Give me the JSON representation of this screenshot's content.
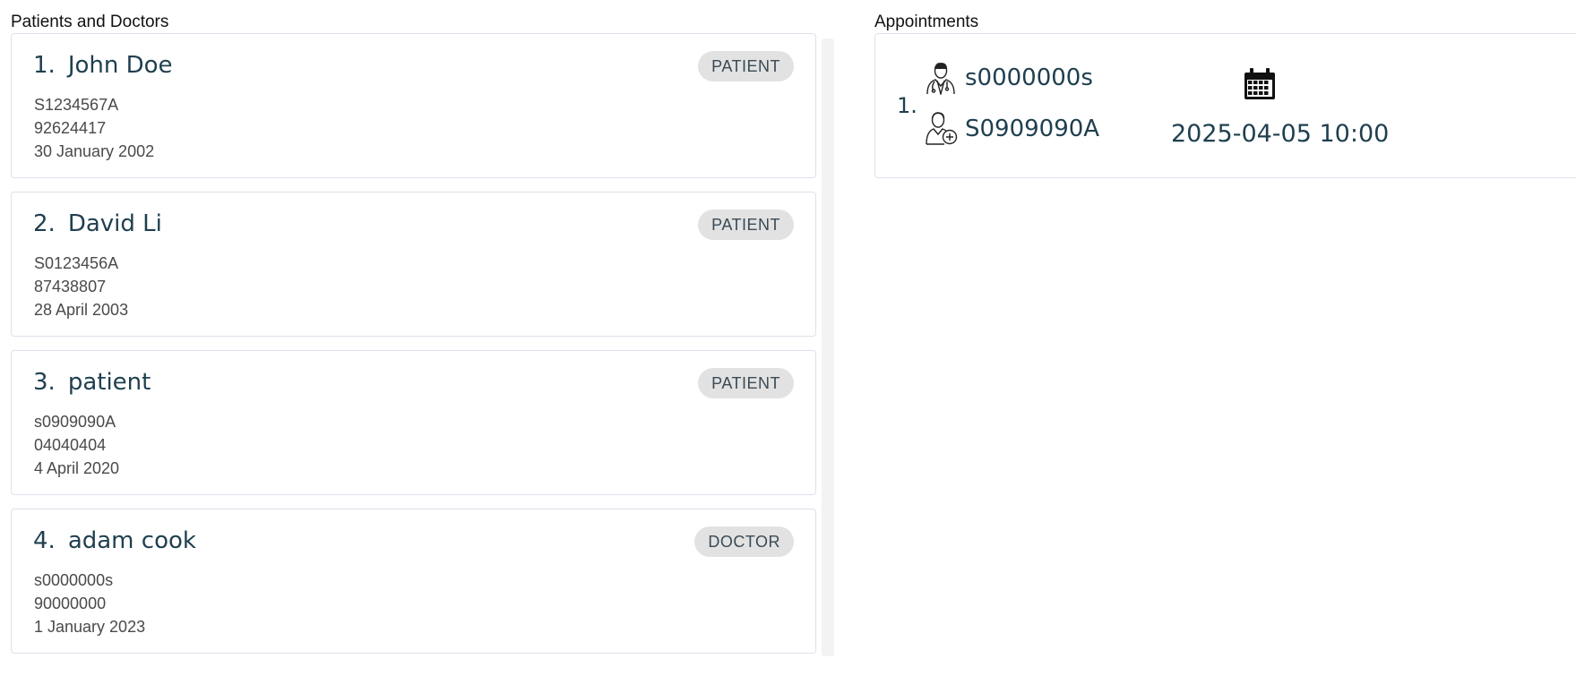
{
  "sections": {
    "people_title": "Patients and Doctors",
    "appointments_title": "Appointments"
  },
  "people": [
    {
      "index": "1.",
      "name": "John Doe",
      "role": "PATIENT",
      "nric": "S1234567A",
      "phone": "92624417",
      "dob": "30 January 2002"
    },
    {
      "index": "2.",
      "name": "David Li",
      "role": "PATIENT",
      "nric": "S0123456A",
      "phone": "87438807",
      "dob": "28 April 2003"
    },
    {
      "index": "3.",
      "name": "patient",
      "role": "PATIENT",
      "nric": "s0909090A",
      "phone": "04040404",
      "dob": "4 April 2020"
    },
    {
      "index": "4.",
      "name": "adam cook",
      "role": "DOCTOR",
      "nric": "s0000000s",
      "phone": "90000000",
      "dob": "1 January 2023"
    }
  ],
  "appointments": [
    {
      "index": "1.",
      "doctor_id": "s0000000s",
      "patient_id": "S0909090A",
      "datetime": "2025-04-05 10:00",
      "icons": {
        "doctor": "doctor-icon",
        "patient": "patient-icon",
        "date": "calendar-icon"
      }
    }
  ],
  "colors": {
    "heading_text": "#1f3f4f",
    "detail_text": "#4a4a4a",
    "badge_bg": "#e2e2e2",
    "card_border": "#dde1ea"
  }
}
